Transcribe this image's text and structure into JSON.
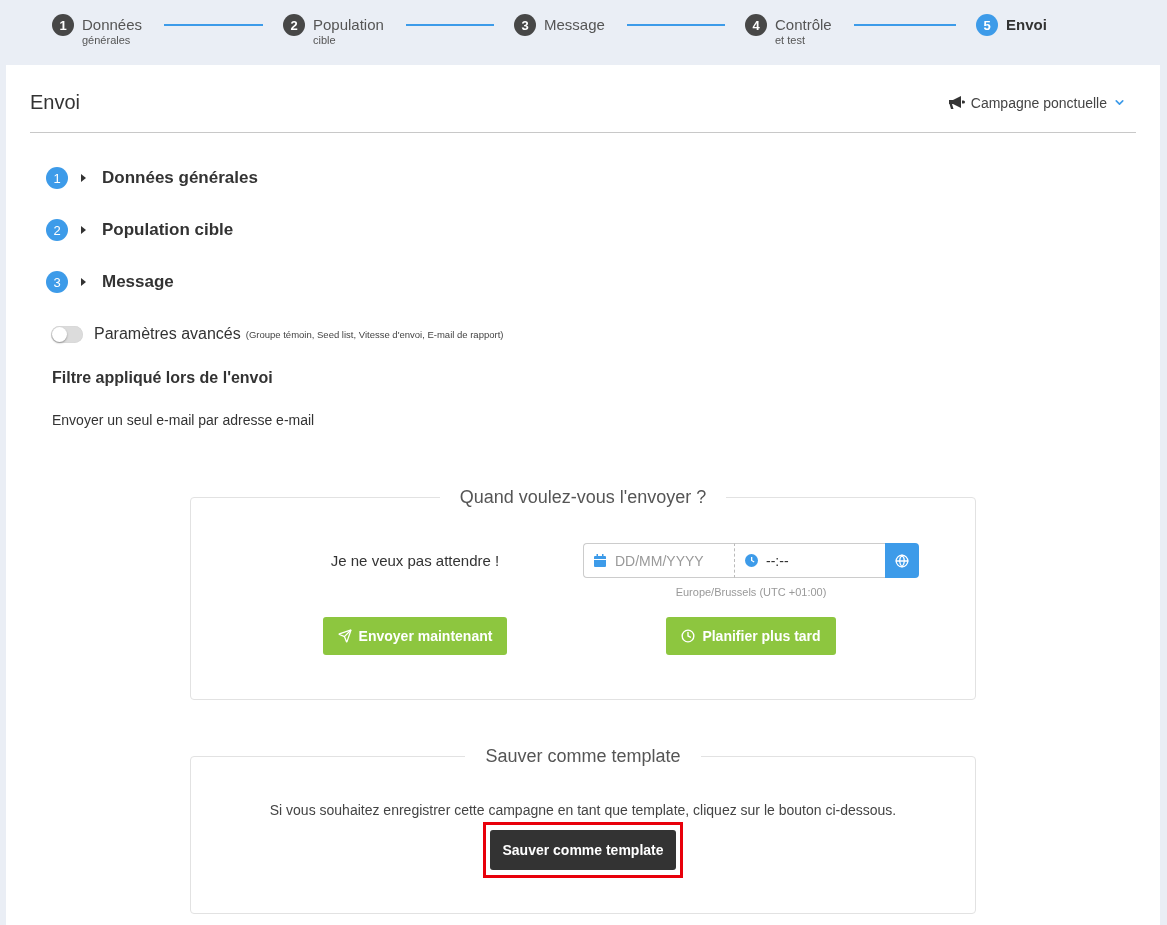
{
  "stepper": [
    {
      "number": "1",
      "label": "Données",
      "sublabel": "générales",
      "selected": false
    },
    {
      "number": "2",
      "label": "Population",
      "sublabel": "cible",
      "selected": false
    },
    {
      "number": "3",
      "label": "Message",
      "selected": false
    },
    {
      "number": "4",
      "label": "Contrôle",
      "sublabel": "et test",
      "selected": false
    },
    {
      "number": "5",
      "label": "Envoi",
      "selected": true
    }
  ],
  "panel": {
    "title": "Envoi",
    "campaign_type": "Campagne ponctuelle"
  },
  "sections": [
    {
      "number": "1",
      "title": "Données générales",
      "expanded": false
    },
    {
      "number": "2",
      "title": "Population cible",
      "expanded": false
    },
    {
      "number": "3",
      "title": "Message",
      "expanded": false
    }
  ],
  "advanced_settings": {
    "label": "Paramètres avancés",
    "hint": "(Groupe témoin, Seed list, Vitesse d'envoi, E-mail de rapport)",
    "on": false
  },
  "filter": {
    "heading": "Filtre appliqué lors de l'envoi",
    "text": "Envoyer un seul e-mail par adresse e-mail"
  },
  "schedule": {
    "legend": "Quand voulez-vous l'envoyer ?",
    "immediate_label": "Je ne veux pas attendre !",
    "date_field": {
      "placeholder": "DD/MM/YYYY"
    },
    "time_field": {
      "placeholder": "--:--"
    },
    "timezone": "Europe/Brussels (UTC +01:00)",
    "buttons": [
      {
        "label": "Envoyer maintenant",
        "kind": "send"
      },
      {
        "label": "Planifier plus tard",
        "kind": "schedule"
      }
    ]
  },
  "template": {
    "legend": "Sauver comme template",
    "text": "Si vous souhaitez enregistrer cette campagne en tant que template, cliquez sur le bouton ci-dessous.",
    "button": {
      "label": "Sauver comme template",
      "highlighted": true
    }
  }
}
